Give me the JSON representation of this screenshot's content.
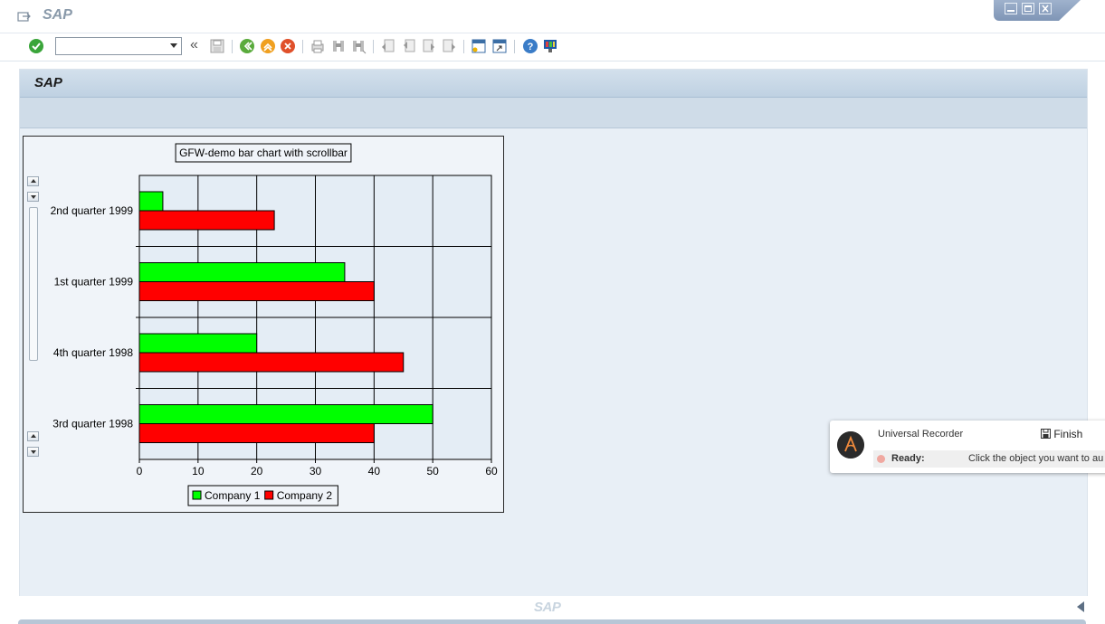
{
  "window": {
    "title": "SAP"
  },
  "toolbar": {
    "command_field_value": "",
    "history_symbol": "«"
  },
  "screen": {
    "title": "SAP"
  },
  "chart_data": {
    "type": "bar",
    "orientation": "horizontal",
    "title": "GFW-demo bar chart with scrollbar",
    "categories": [
      "2nd quarter 1999",
      "1st quarter 1999",
      "4th quarter 1998",
      "3rd quarter 1998"
    ],
    "series": [
      {
        "name": "Company 1",
        "values": [
          4,
          35,
          20,
          50
        ],
        "color": "#00ff00"
      },
      {
        "name": "Company 2",
        "values": [
          23,
          40,
          45,
          40
        ],
        "color": "#ff0000"
      }
    ],
    "xlim": [
      0,
      60
    ],
    "xticks": [
      0,
      10,
      20,
      30,
      40,
      50,
      60
    ],
    "grid": true,
    "legend": "bottom"
  },
  "footer": {
    "logo_text": "SAP"
  },
  "recorder": {
    "name": "Universal Recorder",
    "finish_label": "Finish",
    "status": "Ready:",
    "message": "Click the object you want to au"
  },
  "colors": {
    "accent": "#4a90d9",
    "header_band": "#c7d7e6",
    "content_bg": "#e8eff6"
  },
  "icons": [
    "menu-icon",
    "enter-icon",
    "save-icon",
    "back-icon",
    "exit-icon",
    "cancel-icon",
    "print-icon",
    "find-icon",
    "find-next-icon",
    "first-page-icon",
    "previous-page-icon",
    "next-page-icon",
    "last-page-icon",
    "create-session-icon",
    "shortcut-icon",
    "help-icon",
    "layout-menu-icon"
  ]
}
